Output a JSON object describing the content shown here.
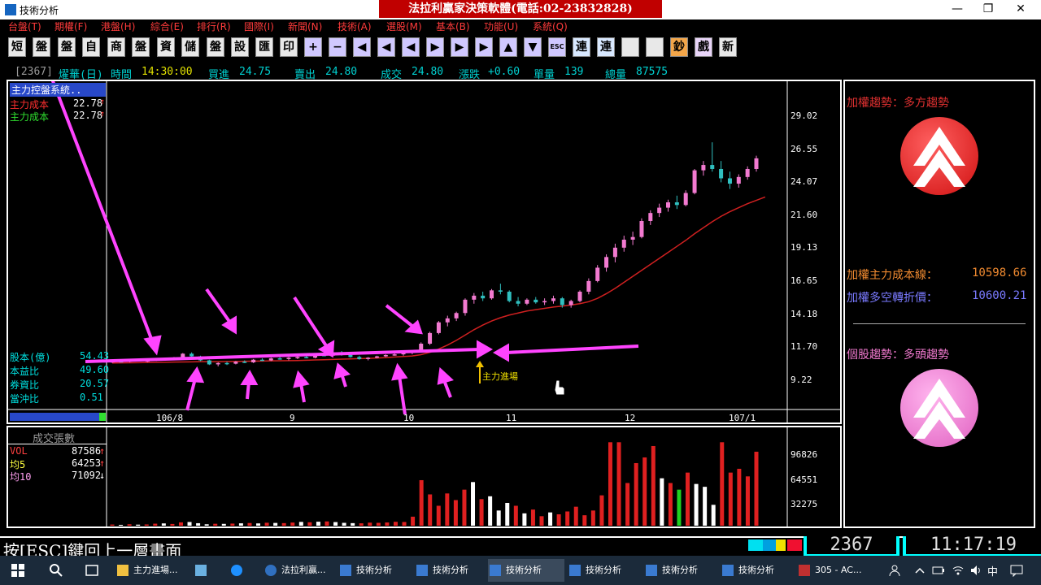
{
  "window": {
    "title": "技術分析",
    "banner": "法拉利贏家決策軟體(電話:02-23832828)",
    "minimize": "—",
    "maximize": "❐",
    "close": "✕"
  },
  "menu": [
    "台盤(T)",
    "期權(F)",
    "港盤(H)",
    "綜合(E)",
    "排行(R)",
    "國際(I)",
    "新聞(N)",
    "技術(A)",
    "選股(M)",
    "基本(B)",
    "功能(U)",
    "系統(Q)"
  ],
  "toolbar": [
    "短",
    "盤",
    "盤",
    "自",
    "商",
    "盤",
    "資",
    "儲",
    "盤",
    "設",
    "匯",
    "印",
    "+",
    "−",
    "◀",
    "◀",
    "◀",
    "▶",
    "▶",
    "▶",
    "▲",
    "▼",
    "ESC",
    "連",
    "連",
    "",
    "",
    "鈔",
    "戲",
    "新"
  ],
  "quote": {
    "code": "[2367]",
    "name": "燿華(日)",
    "time_label": "時間",
    "time": "14:30:00",
    "bid_label": "買進",
    "bid": "24.75",
    "ask_label": "賣出",
    "ask": "24.80",
    "trade_label": "成交",
    "trade": "24.80",
    "change_label": "漲跌",
    "change": "+0.60",
    "vol_label": "單量",
    "vol": "139",
    "total_label": "總量",
    "total": "87575"
  },
  "price_panel": {
    "system_title": "主力控盤系統..",
    "legend": [
      {
        "label": "主力成本",
        "value": "22.78",
        "arrow": "↑",
        "color": "#ff3030"
      },
      {
        "label": "主力成本",
        "value": "22.78",
        "arrow": "↑",
        "color": "#30e030"
      }
    ],
    "stats": [
      {
        "label": "股本(億)",
        "value": "54.43"
      },
      {
        "label": "本益比",
        "value": "49.60"
      },
      {
        "label": "券資比",
        "value": "20.57"
      },
      {
        "label": "當沖比",
        "value": "0.51"
      }
    ],
    "y_ticks": [
      "29.02",
      "26.55",
      "24.07",
      "21.60",
      "19.13",
      "16.65",
      "14.18",
      "11.70",
      "9.22"
    ],
    "x_ticks": [
      "106/8",
      "9",
      "10",
      "11",
      "12",
      "107/1"
    ],
    "annotation": "主力進場"
  },
  "volume_panel": {
    "title": "成交張數",
    "rows": [
      {
        "label": "VOL",
        "value": "87586",
        "arrow": "↑",
        "color": "#ff4040"
      },
      {
        "label": "均5",
        "value": "64253",
        "arrow": "↑",
        "color": "#ffff40"
      },
      {
        "label": "均10",
        "value": "71092",
        "arrow": "↓",
        "color": "#ff9ff0"
      }
    ],
    "y_ticks": [
      "96826",
      "64551",
      "32275"
    ]
  },
  "right_panel": {
    "index_trend": "加權趨勢：多方趨勢",
    "cost_line_label": "加權主力成本線：",
    "cost_line_value": "10598.66",
    "turn_price_label": "加權多空轉折價：",
    "turn_price_value": "10600.21",
    "stock_trend": "個股趨勢：多頭趨勢",
    "colors": {
      "red": "#e02020",
      "pink": "#f27ad0"
    }
  },
  "status": {
    "hint": "按[ESC]鍵回上一層畫面",
    "code": "2367",
    "time": "11:17:19"
  },
  "taskbar": {
    "items": [
      "主力進場...",
      "",
      "",
      "法拉利贏...",
      "技術分析",
      "技術分析",
      "技術分析",
      "技術分析",
      "技術分析",
      "技術分析",
      "305 - AC..."
    ],
    "ime": "中"
  },
  "chart_data": {
    "type": "candlestick",
    "ylim": [
      9.22,
      29.02
    ],
    "candles": [
      {
        "o": 10.55,
        "h": 10.62,
        "l": 10.45,
        "c": 10.58
      },
      {
        "o": 10.58,
        "h": 10.63,
        "l": 10.5,
        "c": 10.55
      },
      {
        "o": 10.55,
        "h": 10.7,
        "l": 10.5,
        "c": 10.66
      },
      {
        "o": 10.66,
        "h": 10.72,
        "l": 10.56,
        "c": 10.6
      },
      {
        "o": 10.6,
        "h": 10.7,
        "l": 10.52,
        "c": 10.64
      },
      {
        "o": 10.64,
        "h": 10.8,
        "l": 10.6,
        "c": 10.75
      },
      {
        "o": 10.75,
        "h": 10.85,
        "l": 10.62,
        "c": 10.7
      },
      {
        "o": 10.7,
        "h": 10.9,
        "l": 10.65,
        "c": 10.85
      },
      {
        "o": 10.85,
        "h": 11.2,
        "l": 10.8,
        "c": 11.15
      },
      {
        "o": 11.15,
        "h": 11.25,
        "l": 10.9,
        "c": 10.95
      },
      {
        "o": 10.95,
        "h": 11.0,
        "l": 10.6,
        "c": 10.65
      },
      {
        "o": 10.65,
        "h": 10.7,
        "l": 10.3,
        "c": 10.35
      },
      {
        "o": 10.35,
        "h": 10.5,
        "l": 10.2,
        "c": 10.45
      },
      {
        "o": 10.45,
        "h": 10.55,
        "l": 10.3,
        "c": 10.4
      },
      {
        "o": 10.4,
        "h": 10.6,
        "l": 10.35,
        "c": 10.55
      },
      {
        "o": 10.55,
        "h": 10.65,
        "l": 10.45,
        "c": 10.5
      },
      {
        "o": 10.5,
        "h": 10.75,
        "l": 10.45,
        "c": 10.7
      },
      {
        "o": 10.7,
        "h": 10.8,
        "l": 10.6,
        "c": 10.65
      },
      {
        "o": 10.65,
        "h": 10.85,
        "l": 10.6,
        "c": 10.8
      },
      {
        "o": 10.8,
        "h": 10.95,
        "l": 10.7,
        "c": 10.75
      },
      {
        "o": 10.75,
        "h": 10.9,
        "l": 10.65,
        "c": 10.85
      },
      {
        "o": 10.85,
        "h": 11.0,
        "l": 10.75,
        "c": 10.9
      },
      {
        "o": 10.9,
        "h": 11.05,
        "l": 10.8,
        "c": 10.85
      },
      {
        "o": 10.85,
        "h": 11.1,
        "l": 10.8,
        "c": 11.05
      },
      {
        "o": 11.05,
        "h": 11.2,
        "l": 10.95,
        "c": 11.0
      },
      {
        "o": 11.0,
        "h": 11.3,
        "l": 10.95,
        "c": 11.25
      },
      {
        "o": 11.25,
        "h": 11.35,
        "l": 11.0,
        "c": 11.05
      },
      {
        "o": 11.05,
        "h": 11.15,
        "l": 10.85,
        "c": 10.9
      },
      {
        "o": 10.9,
        "h": 11.0,
        "l": 10.7,
        "c": 10.75
      },
      {
        "o": 10.75,
        "h": 10.9,
        "l": 10.65,
        "c": 10.85
      },
      {
        "o": 10.85,
        "h": 11.0,
        "l": 10.8,
        "c": 10.95
      },
      {
        "o": 10.95,
        "h": 11.1,
        "l": 10.9,
        "c": 11.05
      },
      {
        "o": 11.05,
        "h": 11.2,
        "l": 11.0,
        "c": 11.1
      },
      {
        "o": 11.1,
        "h": 11.25,
        "l": 11.0,
        "c": 11.2
      },
      {
        "o": 11.2,
        "h": 11.35,
        "l": 11.1,
        "c": 11.3
      },
      {
        "o": 11.3,
        "h": 12.0,
        "l": 11.25,
        "c": 11.9
      },
      {
        "o": 11.9,
        "h": 12.8,
        "l": 11.8,
        "c": 12.7
      },
      {
        "o": 12.7,
        "h": 13.6,
        "l": 12.6,
        "c": 13.5
      },
      {
        "o": 13.5,
        "h": 14.0,
        "l": 13.2,
        "c": 13.8
      },
      {
        "o": 13.8,
        "h": 14.3,
        "l": 13.6,
        "c": 14.2
      },
      {
        "o": 14.2,
        "h": 15.3,
        "l": 14.0,
        "c": 15.2
      },
      {
        "o": 15.2,
        "h": 15.7,
        "l": 14.9,
        "c": 15.5
      },
      {
        "o": 15.5,
        "h": 15.8,
        "l": 15.1,
        "c": 15.3
      },
      {
        "o": 15.3,
        "h": 16.0,
        "l": 15.2,
        "c": 15.9
      },
      {
        "o": 15.9,
        "h": 16.4,
        "l": 15.6,
        "c": 15.8
      },
      {
        "o": 15.8,
        "h": 15.9,
        "l": 15.0,
        "c": 15.1
      },
      {
        "o": 15.1,
        "h": 15.4,
        "l": 14.7,
        "c": 14.9
      },
      {
        "o": 14.9,
        "h": 15.3,
        "l": 14.8,
        "c": 15.2
      },
      {
        "o": 15.2,
        "h": 15.4,
        "l": 14.9,
        "c": 15.0
      },
      {
        "o": 15.0,
        "h": 15.3,
        "l": 14.8,
        "c": 15.1
      },
      {
        "o": 15.1,
        "h": 15.5,
        "l": 14.9,
        "c": 15.3
      },
      {
        "o": 15.3,
        "h": 15.4,
        "l": 14.6,
        "c": 14.8
      },
      {
        "o": 14.8,
        "h": 15.2,
        "l": 14.6,
        "c": 15.1
      },
      {
        "o": 15.1,
        "h": 15.9,
        "l": 15.0,
        "c": 15.8
      },
      {
        "o": 15.8,
        "h": 16.8,
        "l": 15.6,
        "c": 16.6
      },
      {
        "o": 16.6,
        "h": 17.8,
        "l": 16.5,
        "c": 17.6
      },
      {
        "o": 17.6,
        "h": 18.6,
        "l": 17.3,
        "c": 18.4
      },
      {
        "o": 18.4,
        "h": 19.4,
        "l": 18.0,
        "c": 19.1
      },
      {
        "o": 19.1,
        "h": 20.0,
        "l": 18.8,
        "c": 19.7
      },
      {
        "o": 19.7,
        "h": 20.3,
        "l": 19.3,
        "c": 19.9
      },
      {
        "o": 19.9,
        "h": 21.3,
        "l": 19.8,
        "c": 21.1
      },
      {
        "o": 21.1,
        "h": 21.9,
        "l": 20.8,
        "c": 21.7
      },
      {
        "o": 21.7,
        "h": 22.4,
        "l": 21.4,
        "c": 22.1
      },
      {
        "o": 22.1,
        "h": 22.7,
        "l": 21.8,
        "c": 22.5
      },
      {
        "o": 22.5,
        "h": 23.0,
        "l": 22.0,
        "c": 22.3
      },
      {
        "o": 22.3,
        "h": 23.4,
        "l": 22.2,
        "c": 23.2
      },
      {
        "o": 23.2,
        "h": 25.0,
        "l": 23.1,
        "c": 24.9
      },
      {
        "o": 24.9,
        "h": 25.6,
        "l": 24.5,
        "c": 25.3
      },
      {
        "o": 25.3,
        "h": 27.0,
        "l": 24.8,
        "c": 25.0
      },
      {
        "o": 25.0,
        "h": 25.6,
        "l": 24.0,
        "c": 24.3
      },
      {
        "o": 24.3,
        "h": 24.8,
        "l": 23.5,
        "c": 23.9
      },
      {
        "o": 23.9,
        "h": 24.6,
        "l": 23.6,
        "c": 24.4
      },
      {
        "o": 24.4,
        "h": 25.2,
        "l": 24.2,
        "c": 25.0
      },
      {
        "o": 25.0,
        "h": 26.0,
        "l": 24.8,
        "c": 25.8
      }
    ],
    "ma": [
      10.45,
      10.46,
      10.47,
      10.48,
      10.49,
      10.5,
      10.51,
      10.52,
      10.53,
      10.54,
      10.55,
      10.55,
      10.55,
      10.56,
      10.57,
      10.58,
      10.59,
      10.6,
      10.61,
      10.62,
      10.63,
      10.64,
      10.66,
      10.68,
      10.7,
      10.72,
      10.74,
      10.76,
      10.78,
      10.8,
      10.83,
      10.86,
      10.9,
      10.94,
      10.98,
      11.08,
      11.25,
      11.5,
      11.8,
      12.15,
      12.55,
      12.95,
      13.3,
      13.6,
      13.85,
      14.05,
      14.2,
      14.35,
      14.45,
      14.55,
      14.65,
      14.72,
      14.8,
      14.9,
      15.05,
      15.3,
      15.65,
      16.05,
      16.5,
      16.95,
      17.4,
      17.85,
      18.3,
      18.75,
      19.2,
      19.65,
      20.15,
      20.6,
      21.05,
      21.45,
      21.8,
      22.1,
      22.4,
      22.65,
      22.9
    ],
    "volumes": [
      1200,
      900,
      1500,
      1100,
      1300,
      2100,
      2400,
      1800,
      3500,
      3900,
      2600,
      1500,
      2000,
      1900,
      2200,
      2500,
      2800,
      2400,
      3100,
      2900,
      2700,
      3300,
      4000,
      3600,
      4200,
      4500,
      3800,
      3000,
      2700,
      2500,
      3200,
      3000,
      3400,
      4100,
      3900,
      9500,
      48000,
      33000,
      21000,
      34000,
      27000,
      38000,
      46000,
      28000,
      31000,
      16000,
      24000,
      21000,
      13000,
      17000,
      10000,
      14000,
      12000,
      15000,
      20000,
      11000,
      16000,
      32000,
      88000,
      88000,
      45000,
      66000,
      72000,
      84000,
      50000,
      45000,
      38000,
      56000,
      44000,
      41000,
      22000,
      88000,
      56000,
      60000,
      52000,
      78000
    ]
  }
}
